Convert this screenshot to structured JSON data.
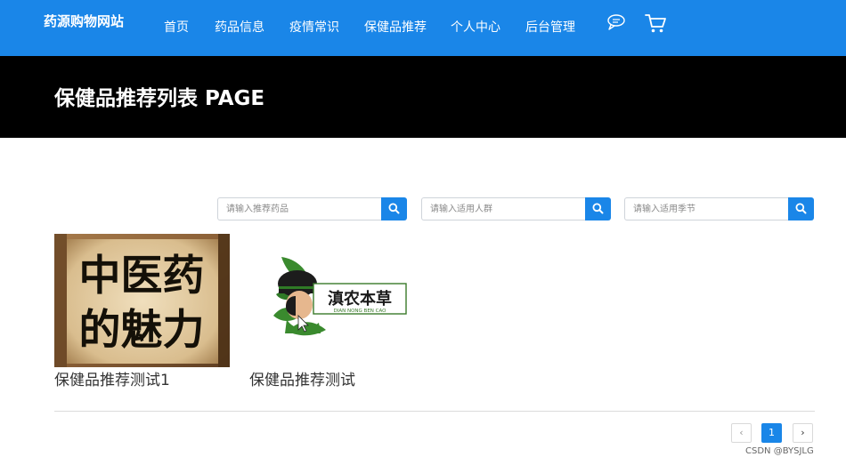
{
  "navbar": {
    "brand": "药源购物网站",
    "items": [
      {
        "label": "首页"
      },
      {
        "label": "药品信息"
      },
      {
        "label": "疫情常识"
      },
      {
        "label": "保健品推荐"
      },
      {
        "label": "个人中心"
      },
      {
        "label": "后台管理"
      }
    ],
    "icons": [
      "chat-icon",
      "cart-icon"
    ]
  },
  "banner": {
    "title": "保健品推荐列表 PAGE"
  },
  "search": {
    "fields": [
      {
        "placeholder": "请输入推荐药品"
      },
      {
        "placeholder": "请输入适用人群"
      },
      {
        "placeholder": "请输入适用季节"
      }
    ],
    "button_icon": "search-icon"
  },
  "products": [
    {
      "name": "保健品推荐测试1",
      "image_text": [
        "中医药",
        "的魅力"
      ]
    },
    {
      "name": "保健品推荐测试",
      "image_logo_text": "滇农本草",
      "image_logo_subtext": "DIAN NONG BEN CAO"
    }
  ],
  "pagination": {
    "prev": "‹",
    "current": "1",
    "next": "›"
  },
  "watermark": "CSDN @BYSJLG",
  "colors": {
    "primary": "#1a86e8",
    "banner": "#000000",
    "logo_green": "#3a8a2e"
  }
}
